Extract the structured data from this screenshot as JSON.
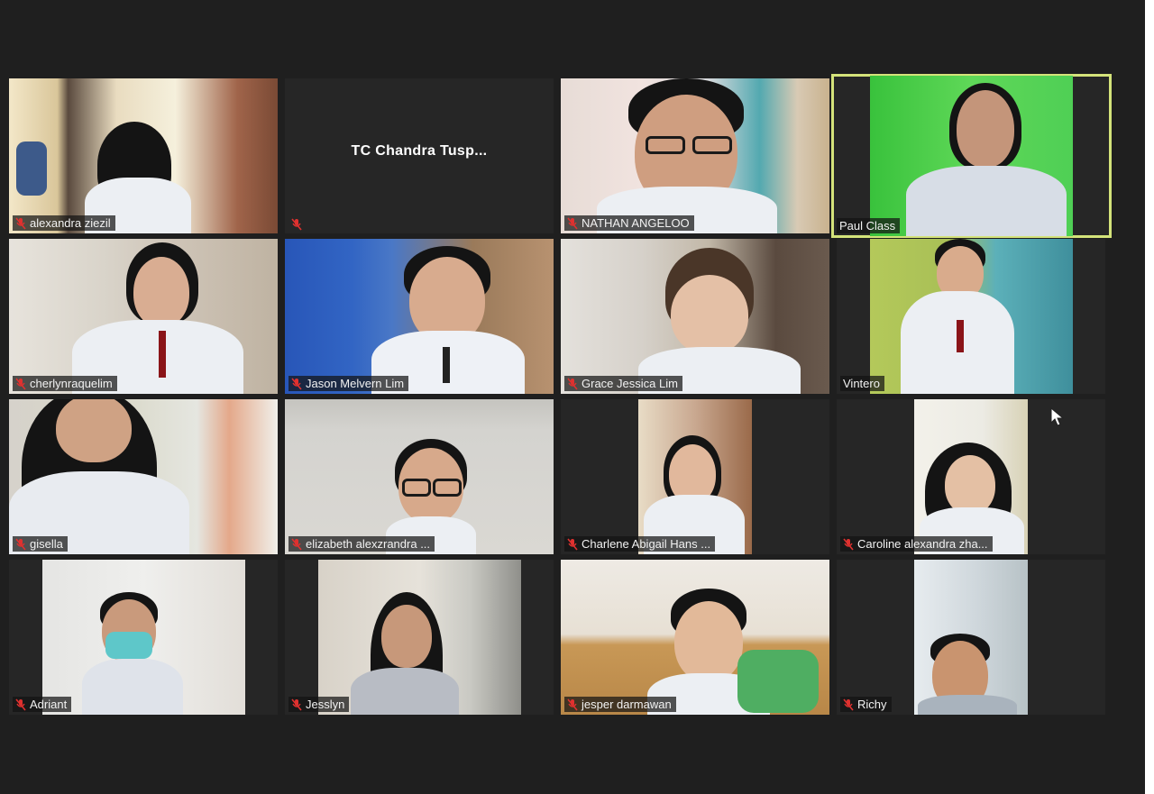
{
  "meeting": {
    "view": "gallery",
    "participants": [
      {
        "name": "alexandra ziezil"
      },
      {
        "name": "TC Chandra Tusp...",
        "video_off": true
      },
      {
        "name": "NATHAN ANGELOO"
      },
      {
        "name": "Paul Class",
        "active_speaker": true
      },
      {
        "name": "cherlynraquelim"
      },
      {
        "name": "Jason Melvern Lim"
      },
      {
        "name": "Grace Jessica Lim"
      },
      {
        "name": "Vintero"
      },
      {
        "name": "gisella"
      },
      {
        "name": "elizabeth alexzrandra ..."
      },
      {
        "name": "Charlene Abigail Hans ..."
      },
      {
        "name": "Caroline alexandra zha..."
      },
      {
        "name": "Adriant"
      },
      {
        "name": "Jesslyn"
      },
      {
        "name": "jesper darmawan"
      },
      {
        "name": "Richy"
      }
    ]
  },
  "colors": {
    "background": "#1f1f1f",
    "tile": "#262626",
    "active_speaker_border": "#d4e37a",
    "muted_icon": "#e0312f"
  },
  "icons": {
    "muted": "mic-muted-icon",
    "cursor": "mouse-pointer-icon"
  }
}
